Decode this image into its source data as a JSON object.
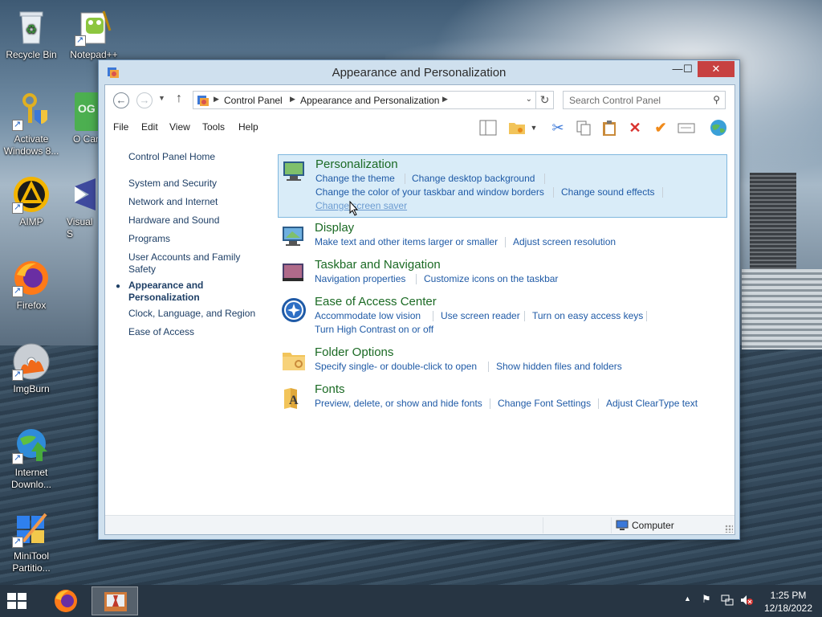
{
  "desktop": {
    "icons": [
      {
        "label": "Recycle Bin",
        "icon": "recycle-bin-icon"
      },
      {
        "label": "Notepad++",
        "icon": "notepad-plus-plus-icon"
      },
      {
        "label": "Activate Windows 8...",
        "icon": "key-shield-icon"
      },
      {
        "label": "O Car",
        "icon": "green-app-icon",
        "badge": "OG"
      },
      {
        "label": "AIMP",
        "icon": "aimp-icon"
      },
      {
        "label": "Visual S",
        "icon": "visual-studio-icon"
      },
      {
        "label": "Firefox",
        "icon": "firefox-icon"
      },
      {
        "label": "ImgBurn",
        "icon": "imgburn-icon"
      },
      {
        "label": "Internet Downlo...",
        "icon": "internet-download-manager-icon"
      },
      {
        "label": "MiniTool Partitio...",
        "icon": "minitool-partition-icon"
      }
    ]
  },
  "window": {
    "title": "Appearance and Personalization",
    "controls": {
      "minimize": "—",
      "maximize": "☐",
      "close": "✕"
    },
    "breadcrumb": [
      "Control Panel",
      "Appearance and Personalization"
    ],
    "search_placeholder": "Search Control Panel",
    "menu": [
      "File",
      "Edit",
      "View",
      "Tools",
      "Help"
    ],
    "toolbar_icons": [
      "layout-pane-icon",
      "new-folder-icon",
      "dropdown-arrow-icon",
      "cut-icon",
      "copy-icon",
      "paste-icon",
      "delete-icon",
      "properties-check-icon",
      "rename-icon",
      "globe-icon"
    ]
  },
  "leftnav": {
    "home": "Control Panel Home",
    "items": [
      "System and Security",
      "Network and Internet",
      "Hardware and Sound",
      "Programs",
      "User Accounts and Family Safety",
      "Appearance and Personalization",
      "Clock, Language, and Region",
      "Ease of Access"
    ],
    "active_index": 5
  },
  "categories": [
    {
      "title": "Personalization",
      "icon": "personalization-icon",
      "links": [
        "Change the theme",
        "Change desktop background",
        "Change the color of your taskbar and window borders",
        "Change sound effects",
        "Change screen saver"
      ]
    },
    {
      "title": "Display",
      "icon": "display-icon",
      "links": [
        "Make text and other items larger or smaller",
        "Adjust screen resolution"
      ]
    },
    {
      "title": "Taskbar and Navigation",
      "icon": "taskbar-icon",
      "links": [
        "Navigation properties",
        "Customize icons on the taskbar"
      ]
    },
    {
      "title": "Ease of Access Center",
      "icon": "ease-of-access-icon",
      "links": [
        "Accommodate low vision",
        "Use screen reader",
        "Turn on easy access keys",
        "Turn High Contrast on or off"
      ]
    },
    {
      "title": "Folder Options",
      "icon": "folder-options-icon",
      "links": [
        "Specify single- or double-click to open",
        "Show hidden files and folders"
      ]
    },
    {
      "title": "Fonts",
      "icon": "fonts-icon",
      "links": [
        "Preview, delete, or show and hide fonts",
        "Change Font Settings",
        "Adjust ClearType text"
      ]
    }
  ],
  "statusbar": {
    "location": "Computer"
  },
  "taskbar": {
    "time": "1:25 PM",
    "date": "12/18/2022"
  },
  "colors": {
    "category_title": "#1b6a24",
    "link": "#1f5aa6",
    "highlight_bg": "#d9ecf8",
    "close_button": "#c74141"
  }
}
